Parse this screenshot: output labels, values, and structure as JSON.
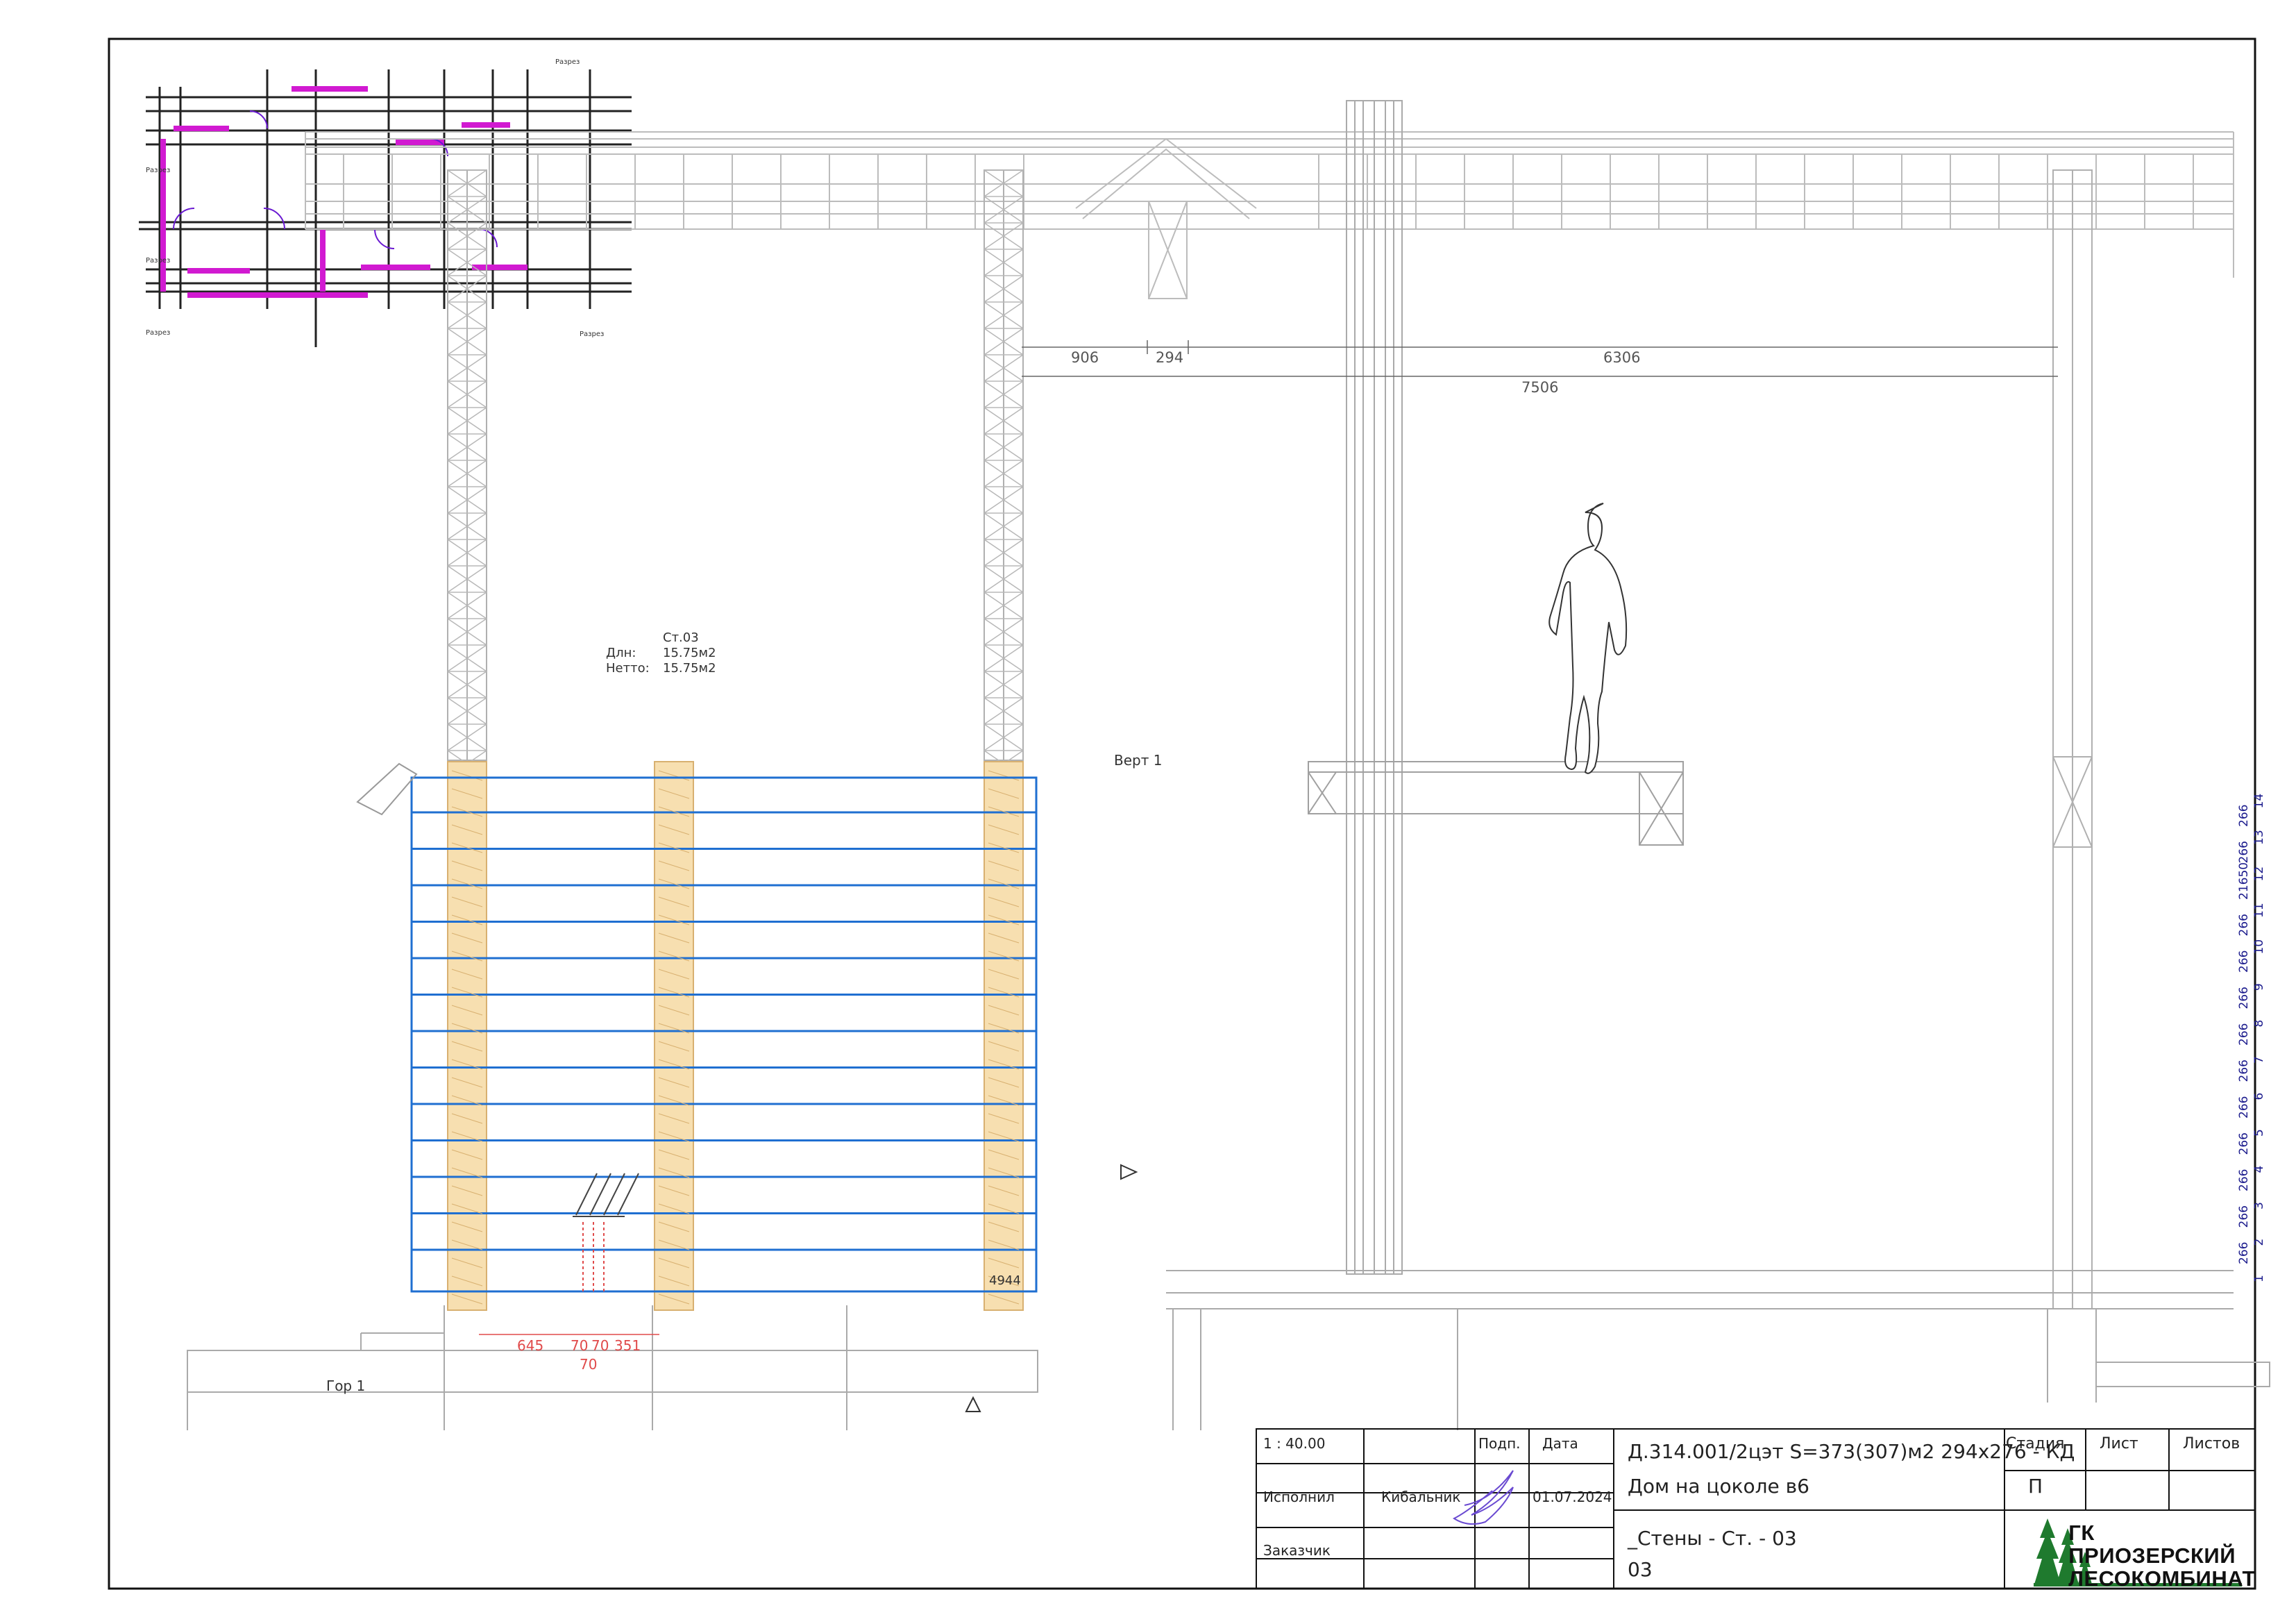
{
  "drawing": {
    "wall_label": {
      "name": "Ст.03",
      "len_label": "Длн:",
      "len_value": "15.75м2",
      "net_label": "Нетто:",
      "net_value": "15.75м2"
    },
    "vert_label": "Верт 1",
    "hor_label": "Гор 1",
    "section_marks": [
      "Разрез",
      "Разрез",
      "Разрез",
      "Разрез",
      "Разрез"
    ],
    "dims_top": {
      "d1": "906",
      "d2": "294",
      "d3": "6306",
      "total": "7506"
    },
    "dims_bottom": {
      "a": "645",
      "b": "70",
      "c": "70",
      "d": "351",
      "e": "70"
    },
    "corner_value": "4944",
    "levels": {
      "values": [
        "266",
        "266",
        "266",
        "266",
        "266",
        "266",
        "266",
        "266",
        "266",
        "266",
        "21650",
        "266",
        "266"
      ],
      "numbers": [
        "1",
        "2",
        "3",
        "4",
        "5",
        "6",
        "7",
        "8",
        "9",
        "10",
        "11",
        "12",
        "13",
        "14"
      ]
    }
  },
  "title_block": {
    "scale": "1 : 40.00",
    "podp": "Подп.",
    "data": "Дата",
    "ispolnil": "Исполнил",
    "author": "Кибальник",
    "date": "01.07.2024",
    "zakazchik": "Заказчик",
    "project_code": "Д.314.001/2цэт S=373(307)м2 294х276 - КД",
    "project_name": "Дом на цоколе в6",
    "sheet_title": "_Стены - Ст. - 03",
    "sheet_sub": "03",
    "stadia": "Стадия",
    "stadia_value": "П",
    "list": "Лист",
    "listov": "Листов",
    "company_line1": "ГК ПРИОЗЕРСКИЙ",
    "company_line2": "ЛЕСОКОМБИНАТ"
  },
  "colors": {
    "wall_blue": "#1f6fd1",
    "log_fill": "#f7dfb0",
    "plan_magenta": "#d11ad1",
    "dim_red": "#e04a4a",
    "level_blue": "#1a1a8c"
  }
}
